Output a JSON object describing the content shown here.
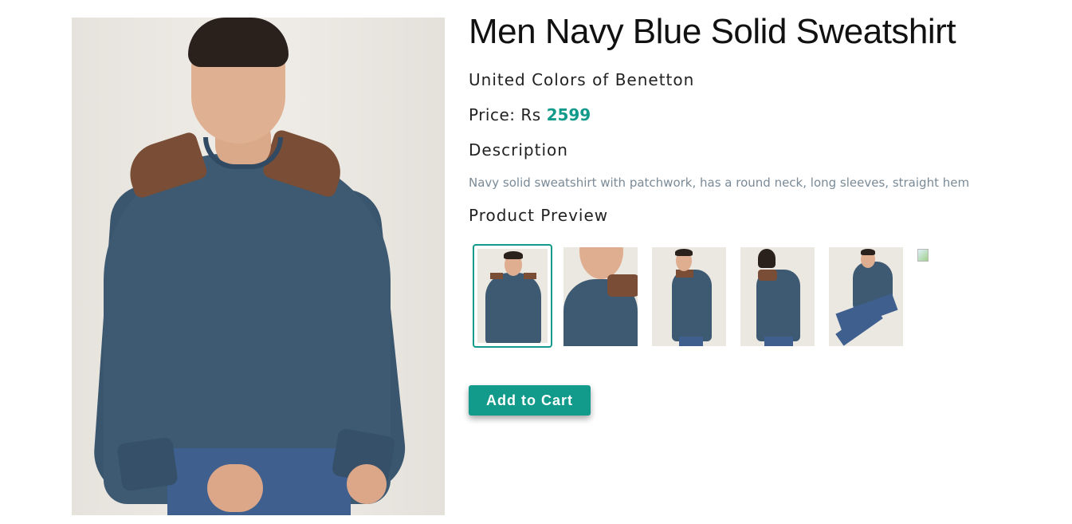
{
  "product": {
    "title": "Men Navy Blue Solid Sweatshirt",
    "brand": "United Colors of Benetton",
    "price_label": "Price: Rs",
    "price_value": "2599",
    "description_heading": "Description",
    "description_text": "Navy solid sweatshirt with patchwork, has a round neck, long sleeves, straight hem",
    "preview_heading": "Product Preview"
  },
  "thumbnails": [
    {
      "view": "front",
      "selected": true
    },
    {
      "view": "closeup",
      "selected": false
    },
    {
      "view": "side",
      "selected": false
    },
    {
      "view": "back",
      "selected": false
    },
    {
      "view": "seated",
      "selected": false
    },
    {
      "view": "broken-image",
      "selected": false
    }
  ],
  "actions": {
    "add_to_cart": "Add to Cart"
  },
  "colors": {
    "accent": "#129a8b",
    "sweatshirt": "#3d5a72",
    "patch": "#7a4e36",
    "muted_text": "#7a8a96"
  }
}
